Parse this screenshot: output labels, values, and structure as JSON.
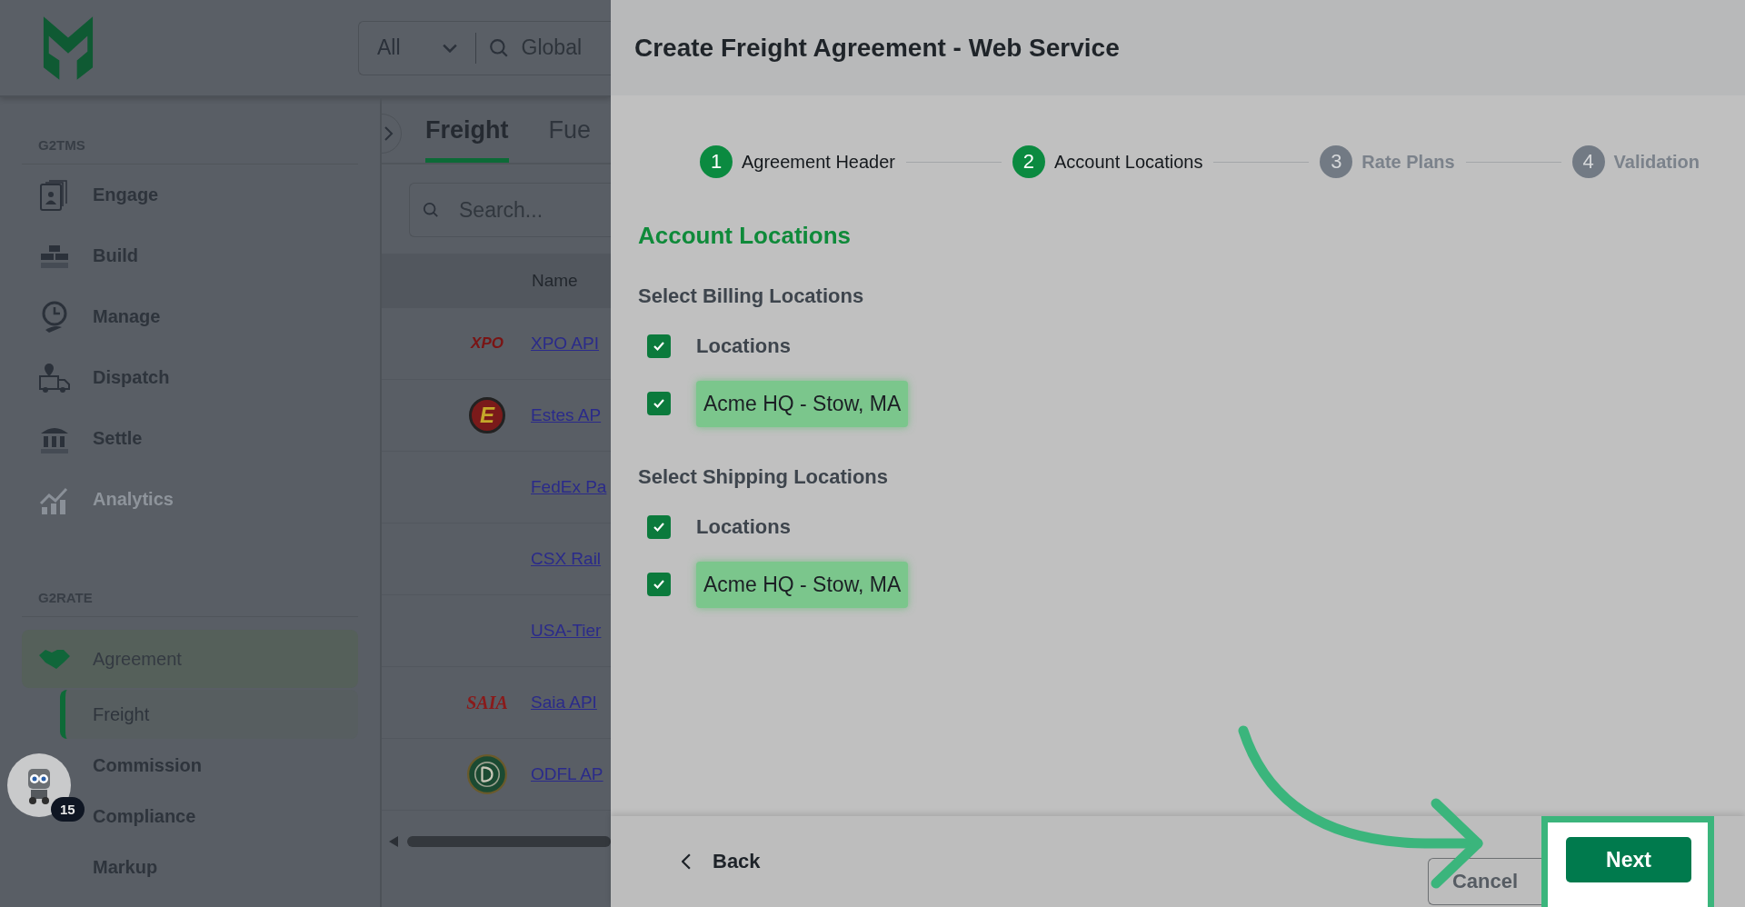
{
  "app_header": {
    "scope_select": {
      "value": "All"
    },
    "global_search": {
      "placeholder": "Global"
    }
  },
  "sidebar": {
    "sections": [
      {
        "title": "G2TMS",
        "items": [
          {
            "label": "Engage",
            "disabled": false
          },
          {
            "label": "Build",
            "disabled": false
          },
          {
            "label": "Manage",
            "disabled": false
          },
          {
            "label": "Dispatch",
            "disabled": false
          },
          {
            "label": "Settle",
            "disabled": false
          },
          {
            "label": "Analytics",
            "disabled": true
          }
        ]
      }
    ],
    "rate_section": {
      "title": "G2RATE",
      "group": {
        "label": "Agreement",
        "expanded": true,
        "children": [
          {
            "label": "Freight",
            "selected": true
          },
          {
            "label": "Commission",
            "selected": false
          },
          {
            "label": "Compliance",
            "selected": false
          },
          {
            "label": "Markup",
            "selected": false
          }
        ]
      }
    }
  },
  "assistant": {
    "count": "15"
  },
  "content": {
    "tabs": [
      {
        "label": "Freight",
        "selected": true
      },
      {
        "label": "Fue",
        "selected": false
      }
    ],
    "search": {
      "placeholder": "Search..."
    },
    "table": {
      "columns": [
        "Name"
      ],
      "rows": [
        {
          "name": "XPO API",
          "kind": "wordmark",
          "logo_text": "XPO"
        },
        {
          "name": "Estes AP",
          "kind": "roundel",
          "logo_text": "E"
        },
        {
          "name": "FedEx Pa",
          "kind": "plain"
        },
        {
          "name": "CSX Rail",
          "kind": "plain"
        },
        {
          "name": "USA-Tier",
          "kind": "plain"
        },
        {
          "name": "Saia API",
          "kind": "script",
          "logo_text": "SAIA"
        },
        {
          "name": "ODFL AP",
          "kind": "seal"
        }
      ]
    }
  },
  "drawer": {
    "title": "Create Freight Agreement - Web Service",
    "steps": [
      {
        "number": "1",
        "label": "Agreement Header",
        "reached": true
      },
      {
        "number": "2",
        "label": "Account Locations",
        "reached": true
      },
      {
        "number": "3",
        "label": "Rate Plans",
        "reached": false
      },
      {
        "number": "4",
        "label": "Validation",
        "reached": false
      }
    ],
    "section_title": "Account Locations",
    "groups": [
      {
        "title": "Select Billing Locations",
        "all": {
          "label": "Locations",
          "checked": true
        },
        "locations": [
          {
            "label": "Acme HQ - Stow, MA",
            "checked": true
          }
        ]
      },
      {
        "title": "Select Shipping Locations",
        "all": {
          "label": "Locations",
          "checked": true
        },
        "locations": [
          {
            "label": "Acme HQ - Stow, MA",
            "checked": true
          }
        ]
      }
    ],
    "footer": {
      "back": "Back",
      "cancel": "Cancel",
      "next": "Next"
    }
  }
}
